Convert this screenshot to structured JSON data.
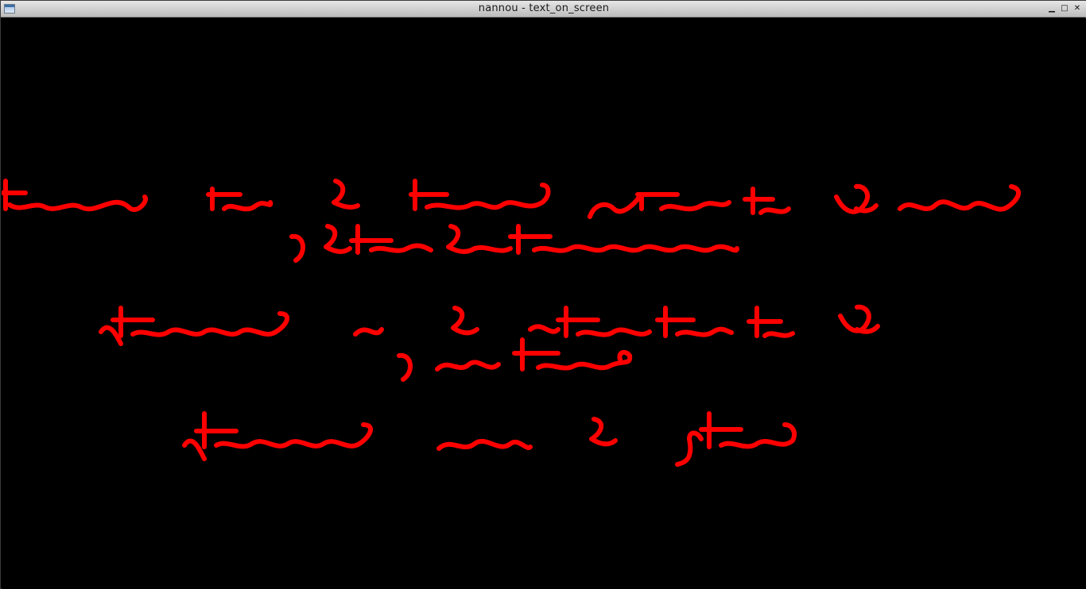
{
  "window": {
    "title": "nannou - text_on_screen",
    "controls": {
      "minimize": "▁",
      "maximize": "□",
      "close": "✕"
    }
  },
  "canvas": {
    "background": "#000000",
    "text_color": "#ff0000",
    "note": ""
  }
}
